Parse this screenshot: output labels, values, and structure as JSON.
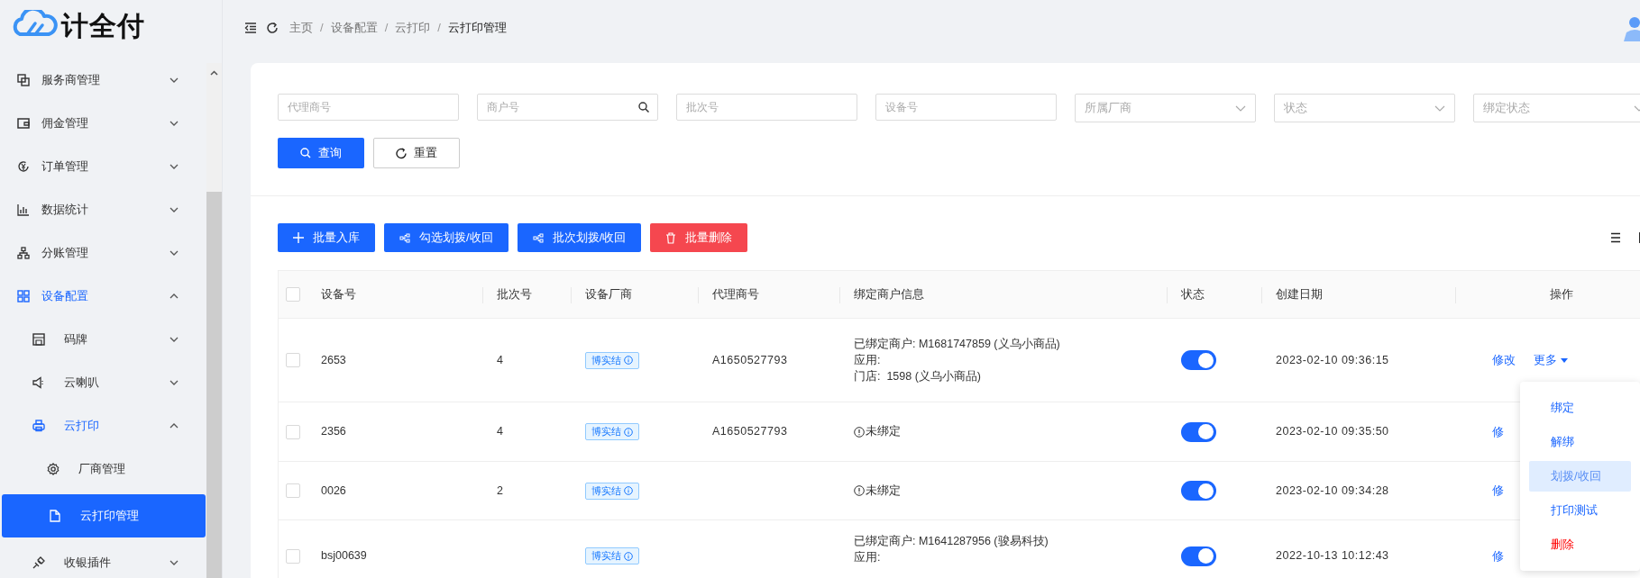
{
  "logo": {
    "text": "计全付"
  },
  "sidebar": {
    "items": [
      {
        "label": "服务商管理",
        "expanded": false,
        "selected": false
      },
      {
        "label": "佣金管理",
        "expanded": false,
        "selected": false
      },
      {
        "label": "订单管理",
        "expanded": false,
        "selected": false
      },
      {
        "label": "数据统计",
        "expanded": false,
        "selected": false
      },
      {
        "label": "分账管理",
        "expanded": false,
        "selected": false
      },
      {
        "label": "设备配置",
        "expanded": true,
        "selected": true,
        "children": [
          {
            "label": "码牌",
            "expanded": false,
            "selected": false
          },
          {
            "label": "云喇叭",
            "expanded": false,
            "selected": false
          },
          {
            "label": "云打印",
            "expanded": true,
            "selected": true,
            "children": [
              {
                "label": "厂商管理",
                "selected": false
              },
              {
                "label": "云打印管理",
                "selected": true
              }
            ]
          },
          {
            "label": "收银插件",
            "expanded": false,
            "selected": false
          }
        ]
      }
    ]
  },
  "breadcrumb": {
    "separator": "/",
    "items": [
      "主页",
      "设备配置",
      "云打印",
      "云打印管理"
    ]
  },
  "filters": [
    {
      "kind": "input",
      "placeholder": "代理商号"
    },
    {
      "kind": "search",
      "placeholder": "商户号"
    },
    {
      "kind": "input",
      "placeholder": "批次号"
    },
    {
      "kind": "input",
      "placeholder": "设备号"
    },
    {
      "kind": "select",
      "placeholder": "所属厂商"
    },
    {
      "kind": "select",
      "placeholder": "状态"
    },
    {
      "kind": "select",
      "placeholder": "绑定状态"
    }
  ],
  "filter_buttons": [
    {
      "kind": "primary",
      "label": "查询"
    },
    {
      "kind": "default",
      "label": "重置"
    }
  ],
  "toolbar_buttons": [
    {
      "kind": "add",
      "label": "批量入库"
    },
    {
      "kind": "transfer",
      "label": "勾选划拨/收回"
    },
    {
      "kind": "transfer",
      "label": "批次划拨/收回"
    },
    {
      "kind": "danger",
      "label": "批量删除"
    }
  ],
  "table": {
    "select_all_checked": false,
    "columns": [
      "设备号",
      "批次号",
      "设备厂商",
      "代理商号",
      "绑定商户信息",
      "状态",
      "创建日期",
      "操作"
    ],
    "rows": [
      {
        "checked": false,
        "device": "2653",
        "batch": "4",
        "vendor": "博实结",
        "agent": "A1650527793",
        "merchant": {
          "kind": "bound",
          "lines": [
            "已绑定商户: M1681747859 (义乌小商品)",
            "应用:",
            "门店:  1598 (义乌小商品)"
          ]
        },
        "on": true,
        "created": "2023-02-10 09:36:15",
        "actions": [
          "修改",
          "更多"
        ]
      },
      {
        "checked": false,
        "device": "2356",
        "batch": "4",
        "vendor": "博实结",
        "agent": "A1650527793",
        "merchant": {
          "kind": "unbound",
          "text": "未绑定"
        },
        "on": true,
        "created": "2023-02-10 09:35:50",
        "actions": [
          "修"
        ]
      },
      {
        "checked": false,
        "device": "0026",
        "batch": "2",
        "vendor": "博实结",
        "agent": "",
        "merchant": {
          "kind": "unbound",
          "text": "未绑定"
        },
        "on": true,
        "created": "2023-02-10 09:34:28",
        "actions": [
          "修"
        ]
      },
      {
        "checked": false,
        "device": "bsj00639",
        "batch": "",
        "vendor": "博实结",
        "agent": "",
        "merchant": {
          "kind": "bound",
          "lines": [
            "已绑定商户: M1641287956 (骏易科技)",
            "应用:"
          ]
        },
        "on": true,
        "created": "2022-10-13 10:12:43",
        "actions": [
          "修"
        ]
      }
    ]
  },
  "dropdown_menu": [
    {
      "label": "绑定",
      "kind": "normal",
      "selected": false
    },
    {
      "label": "解绑",
      "kind": "normal",
      "selected": false
    },
    {
      "label": "划拨/收回",
      "kind": "normal",
      "selected": true
    },
    {
      "label": "打印测试",
      "kind": "normal",
      "selected": false
    },
    {
      "label": "删除",
      "kind": "danger",
      "selected": false
    }
  ]
}
